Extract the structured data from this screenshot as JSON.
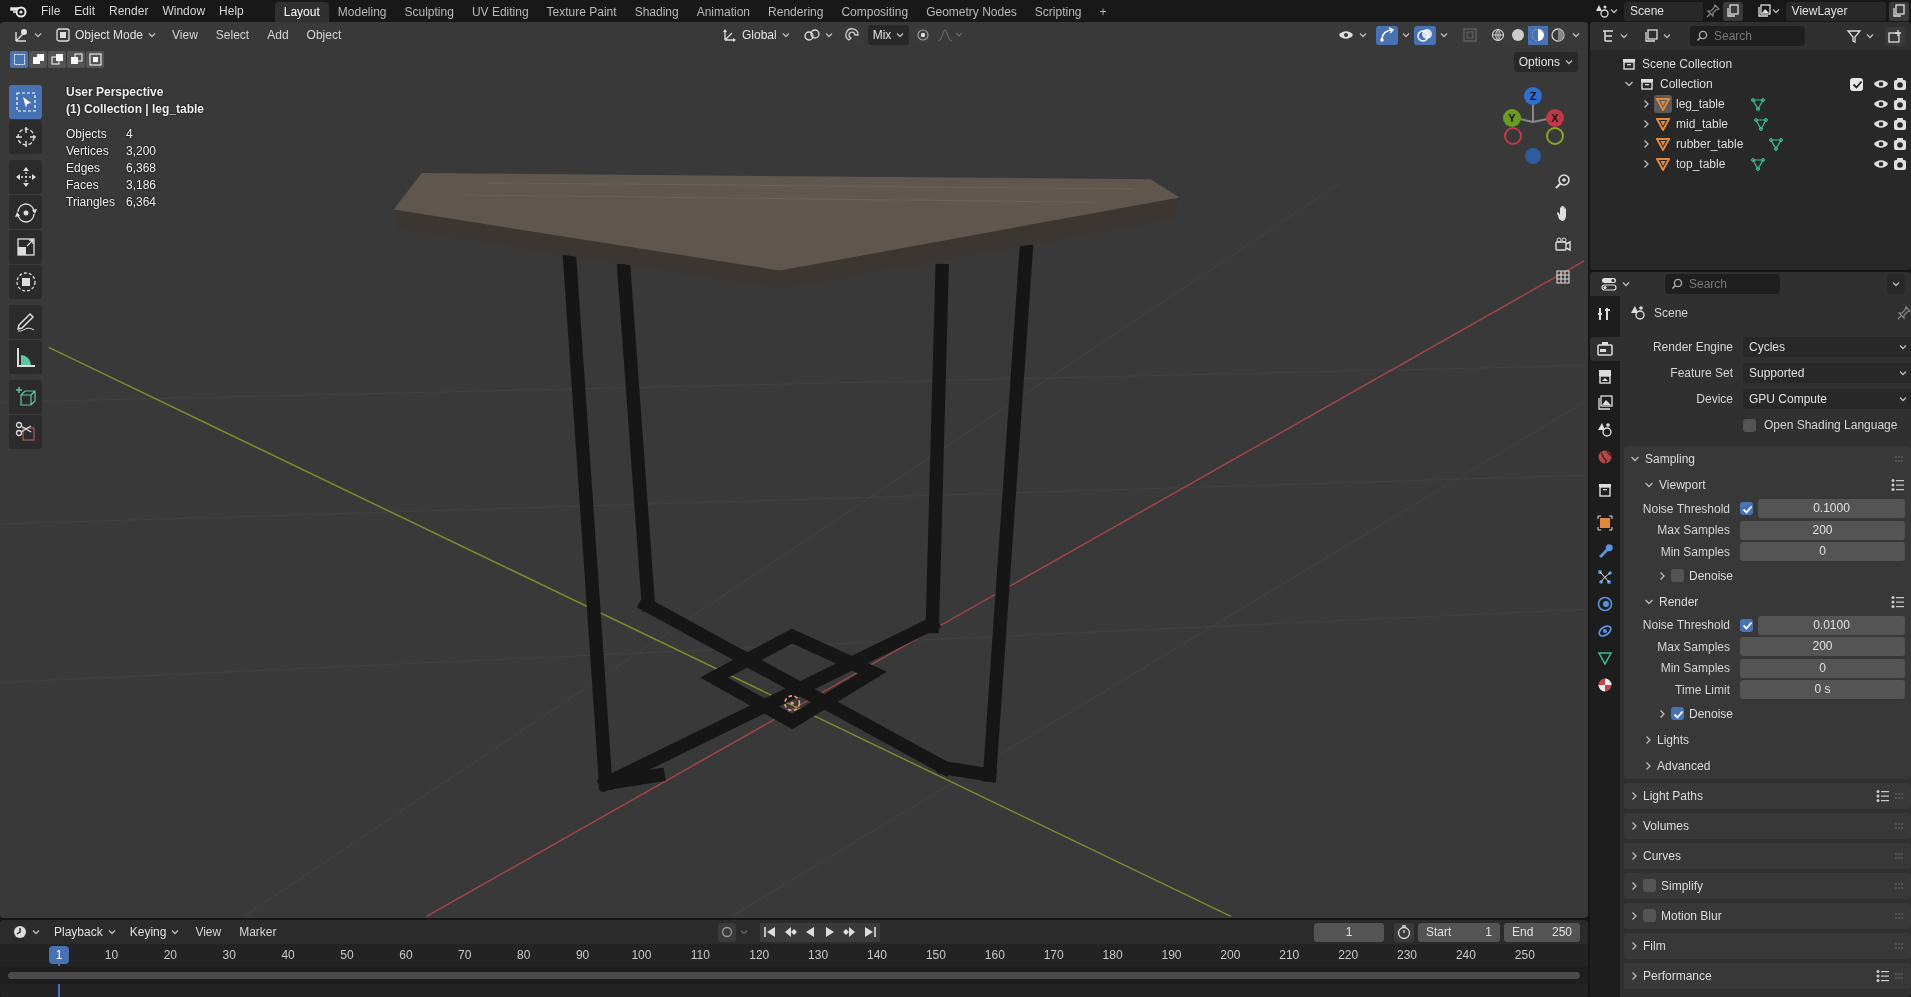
{
  "menu": [
    "File",
    "Edit",
    "Render",
    "Window",
    "Help"
  ],
  "workspaces": [
    {
      "label": "Layout",
      "selected": true
    },
    {
      "label": "Modeling",
      "selected": false
    },
    {
      "label": "Sculpting",
      "selected": false
    },
    {
      "label": "UV Editing",
      "selected": false
    },
    {
      "label": "Texture Paint",
      "selected": false
    },
    {
      "label": "Shading",
      "selected": false
    },
    {
      "label": "Animation",
      "selected": false
    },
    {
      "label": "Rendering",
      "selected": false
    },
    {
      "label": "Compositing",
      "selected": false
    },
    {
      "label": "Geometry Nodes",
      "selected": false
    },
    {
      "label": "Scripting",
      "selected": false
    }
  ],
  "add_workspace": "+",
  "scene": {
    "value": "Scene"
  },
  "view_layer": {
    "value": "ViewLayer"
  },
  "viewport": {
    "mode": "Object Mode",
    "menus": [
      "View",
      "Select",
      "Add",
      "Object"
    ],
    "orientation": "Global",
    "snap": "Mix",
    "gizmos_on": true,
    "overlays_on": true,
    "shading": [
      {
        "selected": false
      },
      {
        "selected": false
      },
      {
        "selected": true
      },
      {
        "selected": false
      }
    ],
    "select_modes": [
      {
        "selected": true
      },
      {
        "selected": false
      },
      {
        "selected": false
      },
      {
        "selected": false
      },
      {
        "selected": false
      }
    ],
    "options": "Options",
    "title": "User Perspective",
    "context": "(1) Collection | leg_table",
    "stats": [
      {
        "label": "Objects",
        "value": "4"
      },
      {
        "label": "Vertices",
        "value": "3,200"
      },
      {
        "label": "Edges",
        "value": "6,368"
      },
      {
        "label": "Faces",
        "value": "3,186"
      },
      {
        "label": "Triangles",
        "value": "6,364"
      }
    ],
    "gizmo_axes": [
      "Z",
      "Y",
      "X"
    ],
    "tools": [
      [
        {
          "kind": "select",
          "selected": true
        },
        {
          "kind": "cursor",
          "selected": false
        }
      ],
      [
        {
          "kind": "move",
          "selected": false
        },
        {
          "kind": "rotate",
          "selected": false
        },
        {
          "kind": "scale",
          "selected": false
        },
        {
          "kind": "transform",
          "selected": false
        }
      ],
      [
        {
          "kind": "annotate",
          "selected": false
        },
        {
          "kind": "measure",
          "selected": false
        }
      ],
      [
        {
          "kind": "add_cube",
          "selected": false
        },
        {
          "kind": "scissors",
          "selected": false
        }
      ]
    ]
  },
  "outliner": {
    "search_placeholder": "Search",
    "tree": [
      {
        "label": "Scene Collection",
        "kind": "scene_collection",
        "children": [
          {
            "label": "Collection",
            "kind": "collection",
            "expanded": true,
            "checked": true,
            "children": [
              {
                "label": "leg_table",
                "kind": "object",
                "expanded": false,
                "selected": true
              },
              {
                "label": "mid_table",
                "kind": "object",
                "expanded": false,
                "selected": false
              },
              {
                "label": "rubber_table",
                "kind": "object",
                "expanded": false,
                "selected": false
              },
              {
                "label": "top_table",
                "kind": "object",
                "expanded": false,
                "selected": false
              }
            ]
          }
        ]
      }
    ]
  },
  "properties": {
    "search_placeholder": "Search",
    "tabs": [
      {
        "kind": "tool",
        "selected": false
      },
      {
        "kind": "render",
        "selected": true
      },
      {
        "kind": "output",
        "selected": false
      },
      {
        "kind": "view_layer",
        "selected": false
      },
      {
        "kind": "scene",
        "selected": false
      },
      {
        "kind": "world",
        "selected": false
      },
      {
        "kind": "collection",
        "selected": false
      },
      {
        "kind": "object",
        "selected": false
      },
      {
        "kind": "modifier",
        "selected": false
      },
      {
        "kind": "particles",
        "selected": false
      },
      {
        "kind": "physics",
        "selected": false
      },
      {
        "kind": "constraint",
        "selected": false
      },
      {
        "kind": "data",
        "selected": false
      },
      {
        "kind": "material",
        "selected": false
      }
    ],
    "context": "Scene",
    "fields": [
      {
        "kind": "dropdown",
        "label": "Render Engine",
        "value": "Cycles"
      },
      {
        "kind": "dropdown",
        "label": "Feature Set",
        "value": "Supported"
      },
      {
        "kind": "dropdown",
        "label": "Device",
        "value": "GPU Compute"
      },
      {
        "kind": "checkbox",
        "label": "Open Shading Language",
        "checked": false
      }
    ],
    "panels": [
      {
        "title": "Sampling",
        "expanded": true,
        "children": [
          {
            "title": "Viewport",
            "expanded": true,
            "presets": true,
            "rows": [
              {
                "label": "Noise Threshold",
                "value": "0.1000",
                "checked": true
              },
              {
                "label": "Max Samples",
                "value": "200"
              },
              {
                "label": "Min Samples",
                "value": "0"
              }
            ],
            "children": [
              {
                "title": "Denoise",
                "expanded": false,
                "checked": false
              }
            ]
          },
          {
            "title": "Render",
            "expanded": true,
            "presets": true,
            "rows": [
              {
                "label": "Noise Threshold",
                "value": "0.0100",
                "checked": true
              },
              {
                "label": "Max Samples",
                "value": "200"
              },
              {
                "label": "Min Samples",
                "value": "0"
              },
              {
                "label": "Time Limit",
                "value": "0 s"
              }
            ],
            "children": [
              {
                "title": "Denoise",
                "expanded": false,
                "checked": true
              }
            ]
          },
          {
            "title": "Lights",
            "expanded": false
          },
          {
            "title": "Advanced",
            "expanded": false
          }
        ]
      },
      {
        "title": "Light Paths",
        "expanded": false,
        "presets": true
      },
      {
        "title": "Volumes",
        "expanded": false
      },
      {
        "title": "Curves",
        "expanded": false
      },
      {
        "title": "Simplify",
        "expanded": false,
        "checked": false
      },
      {
        "title": "Motion Blur",
        "expanded": false,
        "checked": false
      },
      {
        "title": "Film",
        "expanded": false
      },
      {
        "title": "Performance",
        "expanded": false,
        "presets": true
      }
    ]
  },
  "timeline": {
    "menus": [
      "Playback",
      "Keying",
      "View",
      "Marker"
    ],
    "current_frame": "1",
    "start_label": "Start",
    "start": "1",
    "end_label": "End",
    "end": "250",
    "ruler_current": "1",
    "ruler": [
      "10",
      "20",
      "30",
      "40",
      "50",
      "60",
      "70",
      "80",
      "90",
      "100",
      "110",
      "120",
      "130",
      "140",
      "150",
      "160",
      "170",
      "180",
      "190",
      "200",
      "210",
      "220",
      "230",
      "240",
      "250"
    ]
  }
}
